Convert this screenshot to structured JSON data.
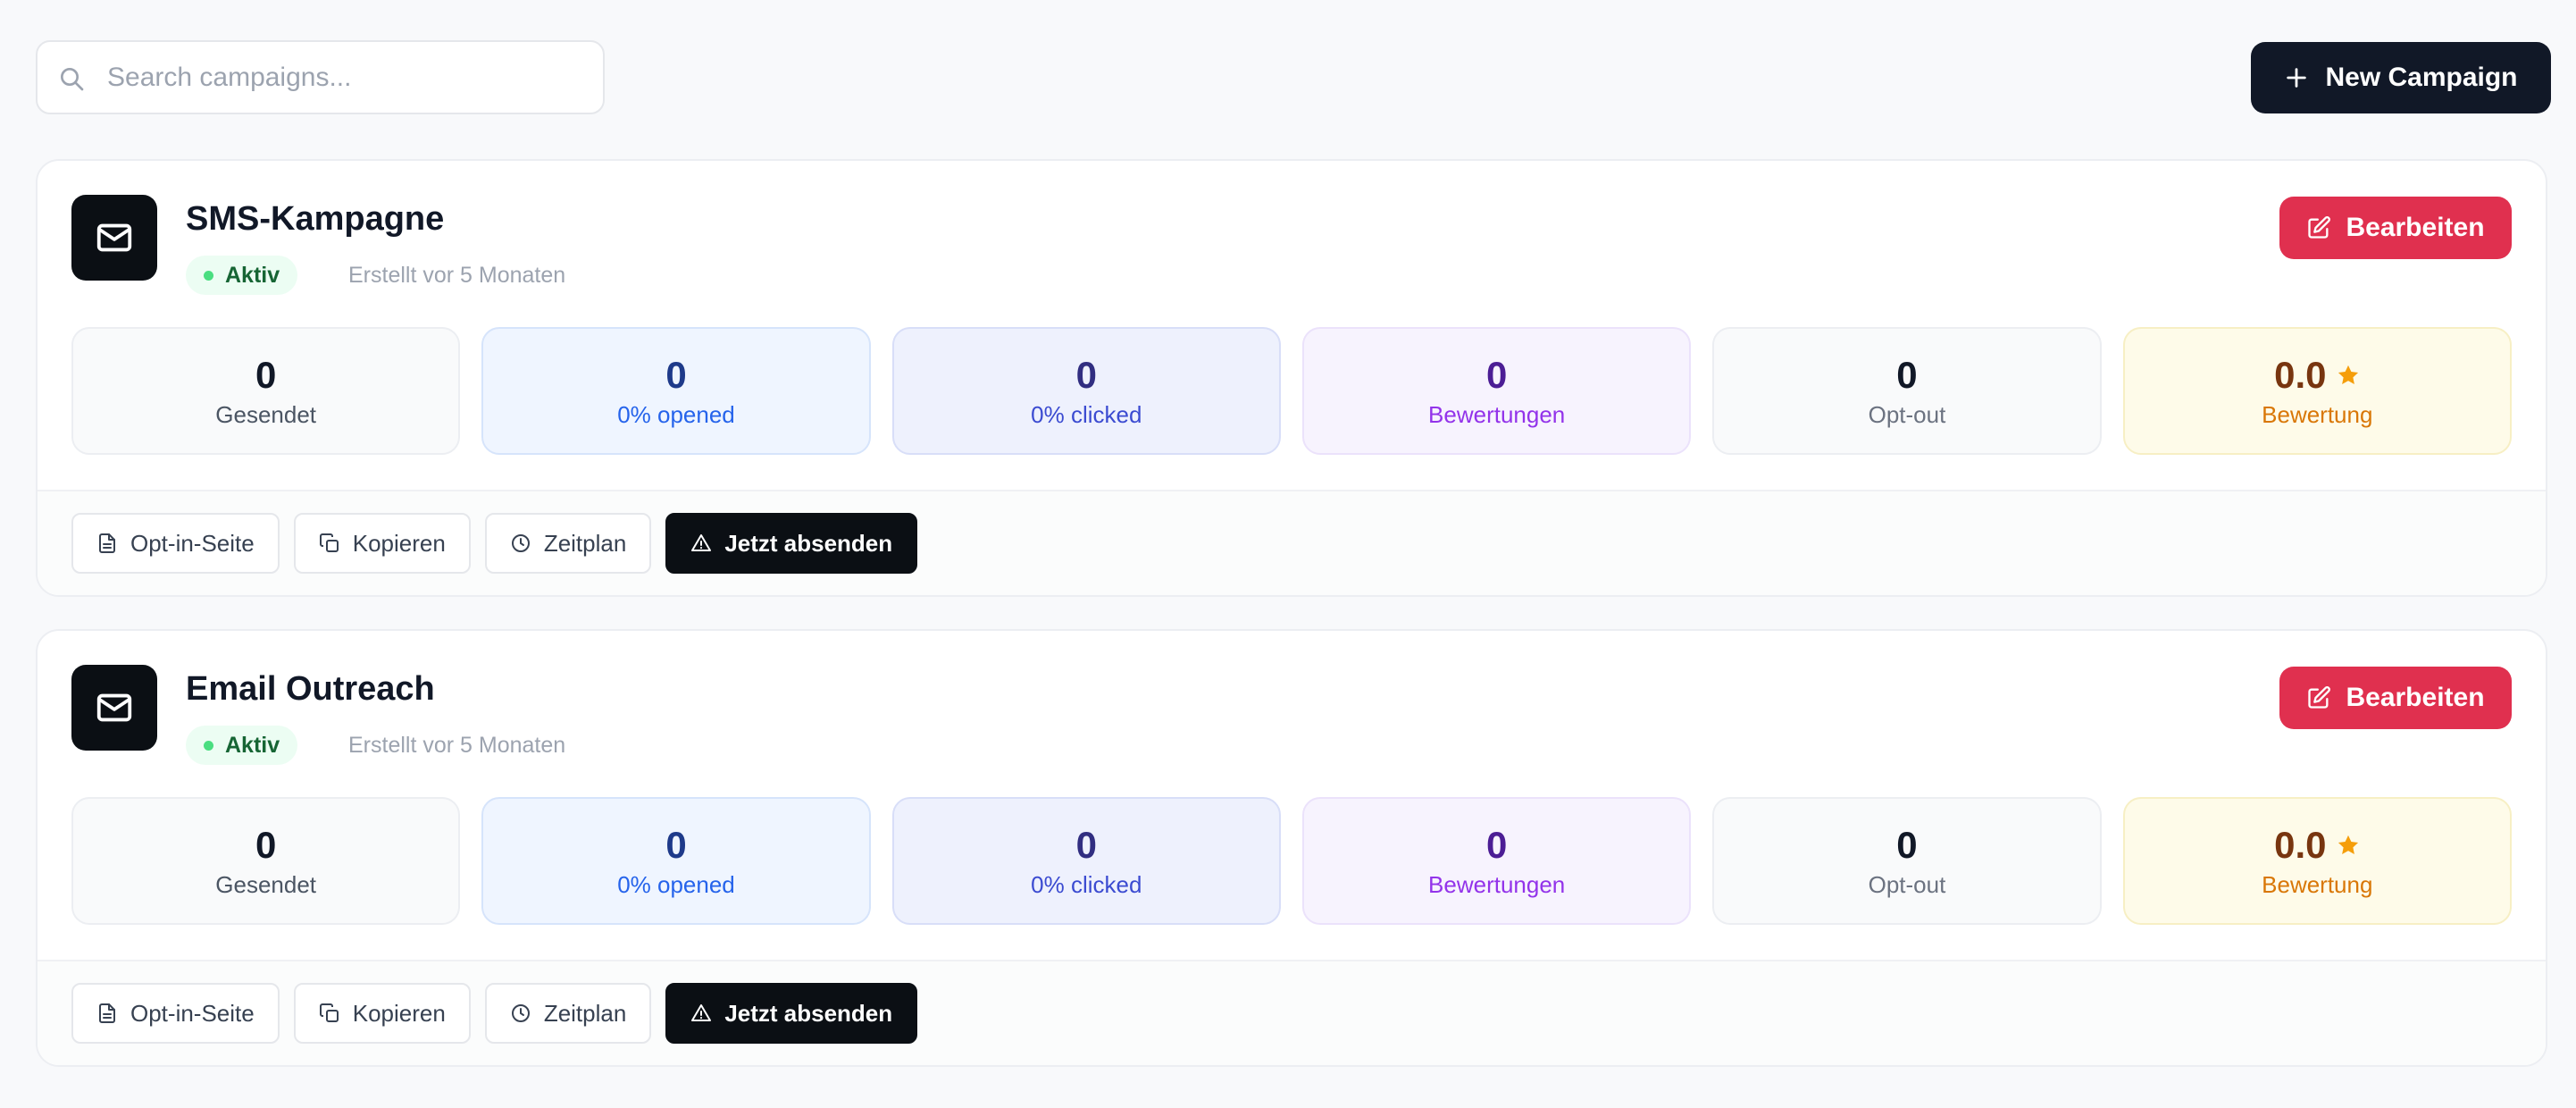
{
  "search": {
    "placeholder": "Search campaigns..."
  },
  "toolbar": {
    "new_campaign_label": "New Campaign"
  },
  "colors": {
    "primary_dark": "#111827",
    "edit_red": "#e0304f",
    "active_green": "#166534",
    "rating_star": "#f59e0b"
  },
  "icons": {
    "search": "search-icon",
    "new": "plus-icon",
    "campaign": "mail-icon",
    "edit": "edit-icon",
    "star": "star-icon",
    "optin": "file-icon",
    "copy": "copy-icon",
    "schedule": "clock-icon",
    "send": "warning-icon"
  },
  "campaigns": [
    {
      "title": "SMS-Kampagne",
      "status": "Aktiv",
      "created": "Erstellt vor 5 Monaten",
      "edit_label": "Bearbeiten",
      "stats": {
        "sent": {
          "value": "0",
          "label": "Gesendet"
        },
        "opened": {
          "value": "0",
          "label": "0% opened"
        },
        "clicked": {
          "value": "0",
          "label": "0% clicked"
        },
        "ratings": {
          "value": "0",
          "label": "Bewertungen"
        },
        "optout": {
          "value": "0",
          "label": "Opt-out"
        },
        "rating": {
          "value": "0.0",
          "label": "Bewertung"
        }
      },
      "actions": {
        "optin": "Opt-in-Seite",
        "copy": "Kopieren",
        "schedule": "Zeitplan",
        "send": "Jetzt absenden"
      }
    },
    {
      "title": "Email Outreach",
      "status": "Aktiv",
      "created": "Erstellt vor 5 Monaten",
      "edit_label": "Bearbeiten",
      "stats": {
        "sent": {
          "value": "0",
          "label": "Gesendet"
        },
        "opened": {
          "value": "0",
          "label": "0% opened"
        },
        "clicked": {
          "value": "0",
          "label": "0% clicked"
        },
        "ratings": {
          "value": "0",
          "label": "Bewertungen"
        },
        "optout": {
          "value": "0",
          "label": "Opt-out"
        },
        "rating": {
          "value": "0.0",
          "label": "Bewertung"
        }
      },
      "actions": {
        "optin": "Opt-in-Seite",
        "copy": "Kopieren",
        "schedule": "Zeitplan",
        "send": "Jetzt absenden"
      }
    }
  ]
}
